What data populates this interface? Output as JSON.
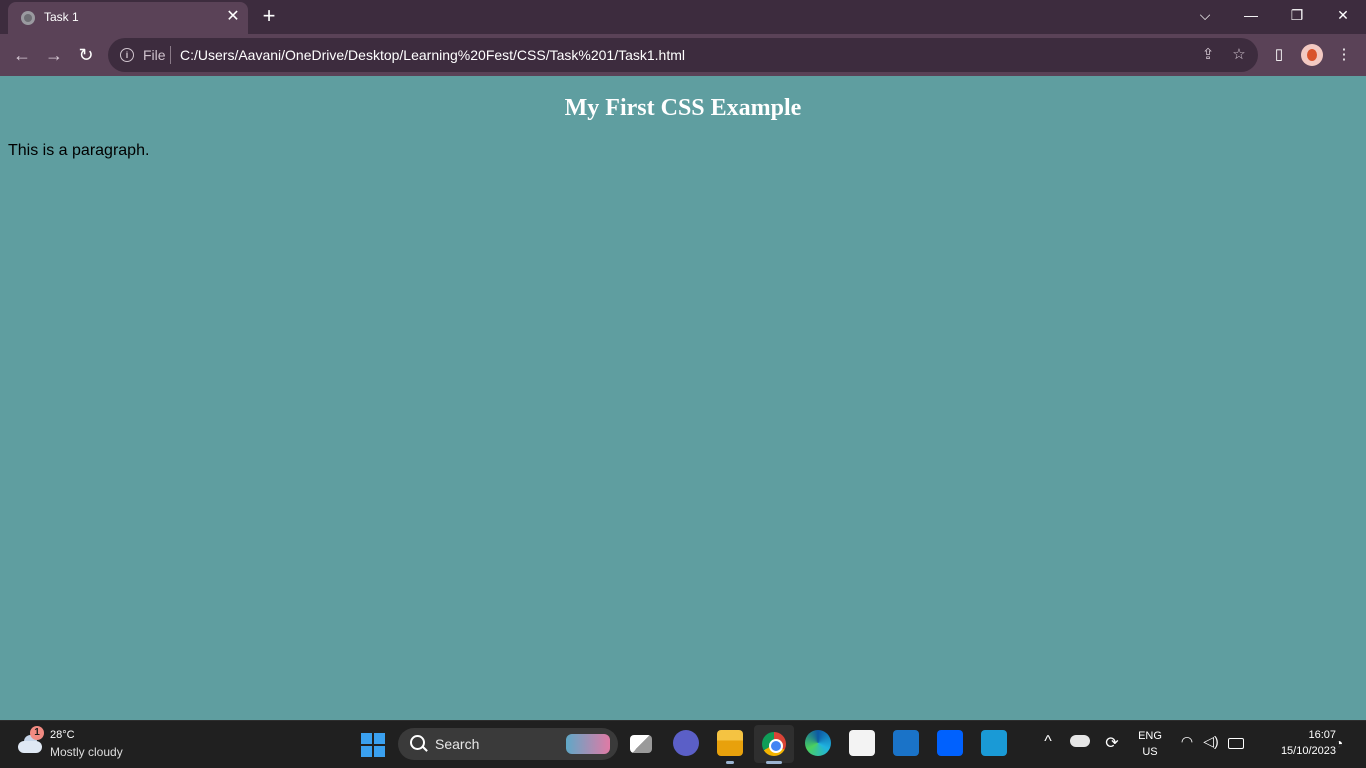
{
  "browser": {
    "tab_title": "Task 1",
    "tab_close": "✕",
    "new_tab": "+",
    "window_controls": {
      "list": "⌵",
      "minimize": "—",
      "restore": "❐",
      "close": "✕"
    },
    "nav": {
      "back": "←",
      "forward": "→",
      "reload": "↻"
    },
    "omnibox": {
      "scheme_label": "File",
      "url": "C:/Users/Aavani/OneDrive/Desktop/Learning%20Fest/CSS/Task%201/Task1.html"
    },
    "toolbar_icons": {
      "share": "⇪",
      "bookmark": "☆",
      "side_panel": "▯",
      "menu": "⋮"
    }
  },
  "page": {
    "heading": "My First CSS Example",
    "paragraph": "This is a paragraph.",
    "background_color": "#5f9ea0"
  },
  "taskbar": {
    "weather": {
      "badge": "1",
      "temperature": "28°C",
      "condition": "Mostly cloudy"
    },
    "search_label": "Search",
    "tray": {
      "chevron": "^",
      "language": "ENG",
      "region": "US"
    },
    "clock": {
      "time": "16:07",
      "date": "15/10/2023"
    }
  }
}
